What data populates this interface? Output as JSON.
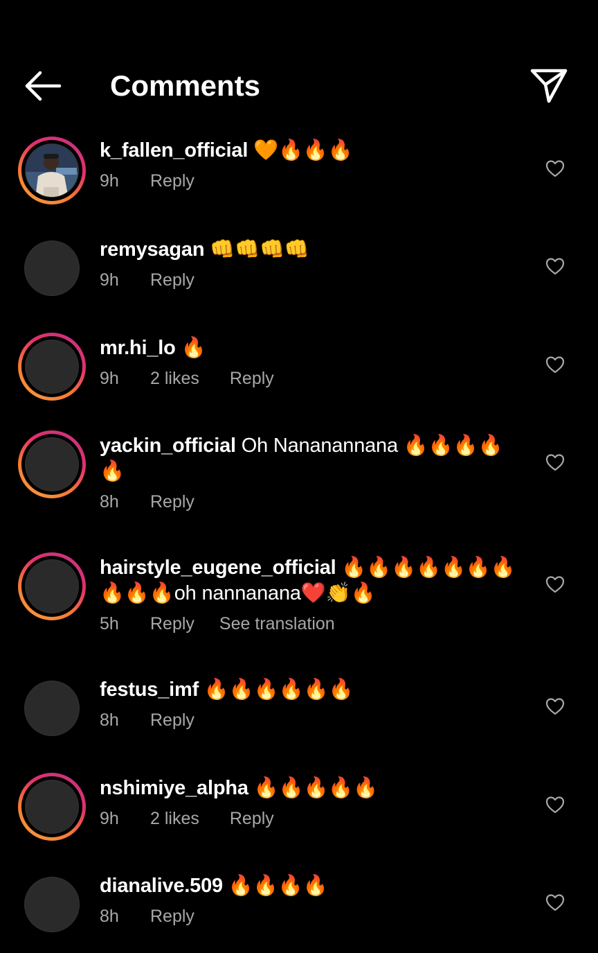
{
  "header": {
    "title": "Comments",
    "back_icon": "arrow-left-icon",
    "send_icon": "paper-plane-icon"
  },
  "colors": {
    "background": "#000000",
    "text": "#ffffff",
    "meta": "#a8a8a8",
    "story_ring": [
      "#f9a23a",
      "#e1306c",
      "#c13584"
    ]
  },
  "comments": [
    {
      "username": "k_fallen_official",
      "text": " 🧡🔥🔥🔥",
      "time": "9h",
      "likes": "",
      "reply": "Reply",
      "extra": "",
      "story_ring": true,
      "photo": true
    },
    {
      "username": "remysagan",
      "text": " 👊👊👊👊",
      "time": "9h",
      "likes": "",
      "reply": "Reply",
      "extra": "",
      "story_ring": false,
      "photo": false
    },
    {
      "username": "mr.hi_lo",
      "text": " 🔥",
      "time": "9h",
      "likes": "2 likes",
      "reply": "Reply",
      "extra": "",
      "story_ring": true,
      "photo": false
    },
    {
      "username": "yackin_official",
      "text": " Oh Nananannana 🔥🔥🔥🔥🔥",
      "time": "8h",
      "likes": "",
      "reply": "Reply",
      "extra": "",
      "story_ring": true,
      "photo": false
    },
    {
      "username": "hairstyle_eugene_official",
      "text": " 🔥🔥🔥🔥🔥🔥🔥🔥🔥🔥oh nannanana❤️👏🔥",
      "time": "5h",
      "likes": "",
      "reply": "Reply",
      "extra": "See translation",
      "story_ring": true,
      "photo": false
    },
    {
      "username": "festus_imf",
      "text": " 🔥🔥🔥🔥🔥🔥",
      "time": "8h",
      "likes": "",
      "reply": "Reply",
      "extra": "",
      "story_ring": false,
      "photo": false
    },
    {
      "username": "nshimiye_alpha",
      "text": " 🔥🔥🔥🔥🔥",
      "time": "9h",
      "likes": "2 likes",
      "reply": "Reply",
      "extra": "",
      "story_ring": true,
      "photo": false
    },
    {
      "username": "dianalive.509",
      "text": " 🔥🔥🔥🔥",
      "time": "8h",
      "likes": "",
      "reply": "Reply",
      "extra": "",
      "story_ring": false,
      "photo": false
    }
  ]
}
